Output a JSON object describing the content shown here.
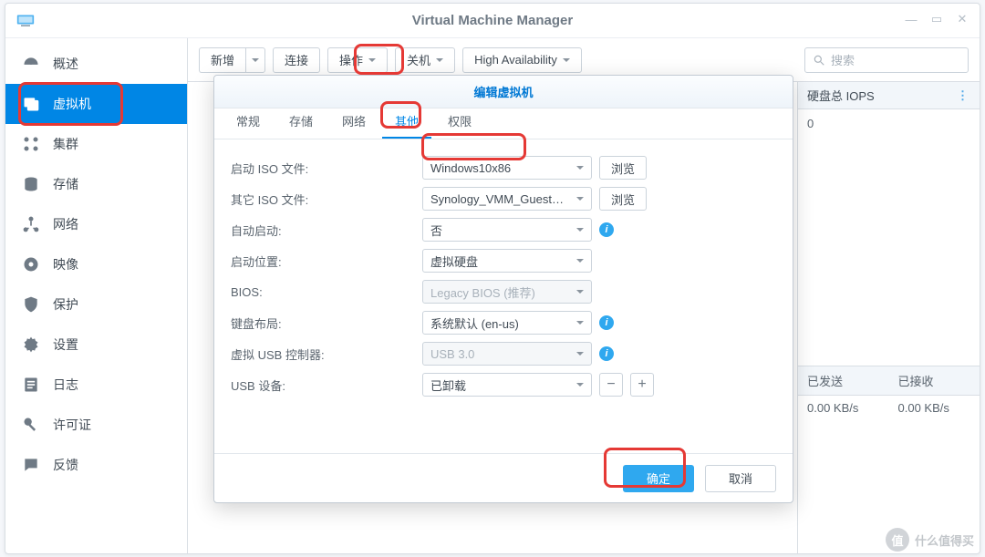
{
  "window": {
    "title": "Virtual Machine Manager"
  },
  "sidebar": {
    "items": [
      {
        "label": "概述"
      },
      {
        "label": "虚拟机"
      },
      {
        "label": "集群"
      },
      {
        "label": "存储"
      },
      {
        "label": "网络"
      },
      {
        "label": "映像"
      },
      {
        "label": "保护"
      },
      {
        "label": "设置"
      },
      {
        "label": "日志"
      },
      {
        "label": "许可证"
      },
      {
        "label": "反馈"
      }
    ]
  },
  "toolbar": {
    "new": "新增",
    "connect": "连接",
    "action": "操作",
    "shutdown": "关机",
    "ha": "High Availability",
    "search_placeholder": "搜索"
  },
  "stats": {
    "iops_label": "硬盘总 IOPS",
    "iops_value": "0",
    "sent_label": "已发送",
    "recv_label": "已接收",
    "sent_value": "0.00 KB/s",
    "recv_value": "0.00 KB/s"
  },
  "modal": {
    "title": "编辑虚拟机",
    "tabs": [
      "常规",
      "存储",
      "网络",
      "其他",
      "权限"
    ],
    "labels": {
      "boot_iso": "启动 ISO 文件:",
      "other_iso": "其它 ISO 文件:",
      "autostart": "自动启动:",
      "boot_from": "启动位置:",
      "bios": "BIOS:",
      "keyboard": "键盘布局:",
      "usb_ctrl": "虚拟 USB 控制器:",
      "usb_dev": "USB 设备:"
    },
    "values": {
      "boot_iso": "Windows10x86",
      "other_iso": "Synology_VMM_Guest_Tool",
      "autostart": "否",
      "boot_from": "虚拟硬盘",
      "bios": "Legacy BIOS (推荐)",
      "keyboard": "系统默认 (en-us)",
      "usb_ctrl": "USB 3.0",
      "usb_dev": "已卸载"
    },
    "browse": "浏览",
    "ok": "确定",
    "cancel": "取消"
  },
  "watermark": {
    "char": "值",
    "text": "什么值得买"
  }
}
